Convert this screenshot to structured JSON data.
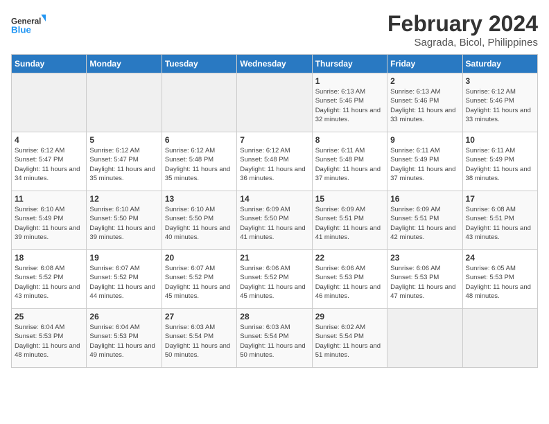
{
  "logo": {
    "line1": "General",
    "line2": "Blue"
  },
  "title": "February 2024",
  "location": "Sagrada, Bicol, Philippines",
  "days_of_week": [
    "Sunday",
    "Monday",
    "Tuesday",
    "Wednesday",
    "Thursday",
    "Friday",
    "Saturday"
  ],
  "weeks": [
    [
      {
        "day": "",
        "sunrise": "",
        "sunset": "",
        "daylight": "",
        "empty": true
      },
      {
        "day": "",
        "sunrise": "",
        "sunset": "",
        "daylight": "",
        "empty": true
      },
      {
        "day": "",
        "sunrise": "",
        "sunset": "",
        "daylight": "",
        "empty": true
      },
      {
        "day": "",
        "sunrise": "",
        "sunset": "",
        "daylight": "",
        "empty": true
      },
      {
        "day": "1",
        "sunrise": "6:13 AM",
        "sunset": "5:46 PM",
        "daylight": "11 hours and 32 minutes."
      },
      {
        "day": "2",
        "sunrise": "6:13 AM",
        "sunset": "5:46 PM",
        "daylight": "11 hours and 33 minutes."
      },
      {
        "day": "3",
        "sunrise": "6:12 AM",
        "sunset": "5:46 PM",
        "daylight": "11 hours and 33 minutes."
      }
    ],
    [
      {
        "day": "4",
        "sunrise": "6:12 AM",
        "sunset": "5:47 PM",
        "daylight": "11 hours and 34 minutes."
      },
      {
        "day": "5",
        "sunrise": "6:12 AM",
        "sunset": "5:47 PM",
        "daylight": "11 hours and 35 minutes."
      },
      {
        "day": "6",
        "sunrise": "6:12 AM",
        "sunset": "5:48 PM",
        "daylight": "11 hours and 35 minutes."
      },
      {
        "day": "7",
        "sunrise": "6:12 AM",
        "sunset": "5:48 PM",
        "daylight": "11 hours and 36 minutes."
      },
      {
        "day": "8",
        "sunrise": "6:11 AM",
        "sunset": "5:48 PM",
        "daylight": "11 hours and 37 minutes."
      },
      {
        "day": "9",
        "sunrise": "6:11 AM",
        "sunset": "5:49 PM",
        "daylight": "11 hours and 37 minutes."
      },
      {
        "day": "10",
        "sunrise": "6:11 AM",
        "sunset": "5:49 PM",
        "daylight": "11 hours and 38 minutes."
      }
    ],
    [
      {
        "day": "11",
        "sunrise": "6:10 AM",
        "sunset": "5:49 PM",
        "daylight": "11 hours and 39 minutes."
      },
      {
        "day": "12",
        "sunrise": "6:10 AM",
        "sunset": "5:50 PM",
        "daylight": "11 hours and 39 minutes."
      },
      {
        "day": "13",
        "sunrise": "6:10 AM",
        "sunset": "5:50 PM",
        "daylight": "11 hours and 40 minutes."
      },
      {
        "day": "14",
        "sunrise": "6:09 AM",
        "sunset": "5:50 PM",
        "daylight": "11 hours and 41 minutes."
      },
      {
        "day": "15",
        "sunrise": "6:09 AM",
        "sunset": "5:51 PM",
        "daylight": "11 hours and 41 minutes."
      },
      {
        "day": "16",
        "sunrise": "6:09 AM",
        "sunset": "5:51 PM",
        "daylight": "11 hours and 42 minutes."
      },
      {
        "day": "17",
        "sunrise": "6:08 AM",
        "sunset": "5:51 PM",
        "daylight": "11 hours and 43 minutes."
      }
    ],
    [
      {
        "day": "18",
        "sunrise": "6:08 AM",
        "sunset": "5:52 PM",
        "daylight": "11 hours and 43 minutes."
      },
      {
        "day": "19",
        "sunrise": "6:07 AM",
        "sunset": "5:52 PM",
        "daylight": "11 hours and 44 minutes."
      },
      {
        "day": "20",
        "sunrise": "6:07 AM",
        "sunset": "5:52 PM",
        "daylight": "11 hours and 45 minutes."
      },
      {
        "day": "21",
        "sunrise": "6:06 AM",
        "sunset": "5:52 PM",
        "daylight": "11 hours and 45 minutes."
      },
      {
        "day": "22",
        "sunrise": "6:06 AM",
        "sunset": "5:53 PM",
        "daylight": "11 hours and 46 minutes."
      },
      {
        "day": "23",
        "sunrise": "6:06 AM",
        "sunset": "5:53 PM",
        "daylight": "11 hours and 47 minutes."
      },
      {
        "day": "24",
        "sunrise": "6:05 AM",
        "sunset": "5:53 PM",
        "daylight": "11 hours and 48 minutes."
      }
    ],
    [
      {
        "day": "25",
        "sunrise": "6:04 AM",
        "sunset": "5:53 PM",
        "daylight": "11 hours and 48 minutes."
      },
      {
        "day": "26",
        "sunrise": "6:04 AM",
        "sunset": "5:53 PM",
        "daylight": "11 hours and 49 minutes."
      },
      {
        "day": "27",
        "sunrise": "6:03 AM",
        "sunset": "5:54 PM",
        "daylight": "11 hours and 50 minutes."
      },
      {
        "day": "28",
        "sunrise": "6:03 AM",
        "sunset": "5:54 PM",
        "daylight": "11 hours and 50 minutes."
      },
      {
        "day": "29",
        "sunrise": "6:02 AM",
        "sunset": "5:54 PM",
        "daylight": "11 hours and 51 minutes."
      },
      {
        "day": "",
        "sunrise": "",
        "sunset": "",
        "daylight": "",
        "empty": true
      },
      {
        "day": "",
        "sunrise": "",
        "sunset": "",
        "daylight": "",
        "empty": true
      }
    ]
  ]
}
